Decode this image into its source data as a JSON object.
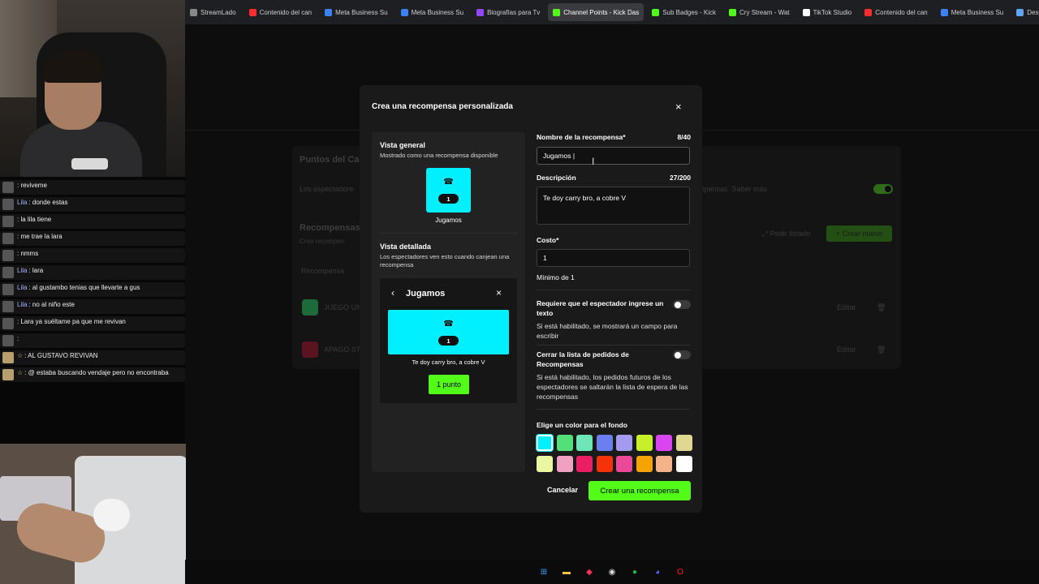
{
  "browser": {
    "tabs": [
      {
        "label": "StreamLado",
        "color": "#888888"
      },
      {
        "label": "Contenido del can",
        "color": "#ff2d2d"
      },
      {
        "label": "Meta Business Su",
        "color": "#3b82f6"
      },
      {
        "label": "Meta Business Su",
        "color": "#3b82f6"
      },
      {
        "label": "Biografías para Tv",
        "color": "#9146ff"
      },
      {
        "label": "Channel Points - Kick Das",
        "color": "#53fc18",
        "active": true
      },
      {
        "label": "Sub Badges - Kick",
        "color": "#53fc18"
      },
      {
        "label": "Cry Stream - Wat",
        "color": "#53fc18"
      },
      {
        "label": "TikTok Studio",
        "color": "#ffffff"
      },
      {
        "label": "Contenido del can",
        "color": "#ff2d2d"
      },
      {
        "label": "Meta Business Su",
        "color": "#3b82f6"
      },
      {
        "label": "Descargar arch",
        "color": "#60a5fa"
      }
    ]
  },
  "background": {
    "section_title": "Puntos del Ca",
    "info_text": "Los espectadore",
    "info_tail": "mpensas. Saber más",
    "rewards_title": "Recompensas",
    "rewards_sub": "Crea recompen",
    "request_label": "Pedir listado",
    "create_new_label": "Crear nuevo",
    "col_header": "Recompensa",
    "rows": [
      {
        "name": "JUEGO UN",
        "edit": "Editar",
        "icon_color": "#1d6b3a"
      },
      {
        "name": "APAGO ST",
        "edit": "Editar",
        "icon_color": "#5a1420"
      }
    ]
  },
  "chat": [
    {
      "name": "",
      "text": ": reviveme",
      "gold": false
    },
    {
      "name": "Lila",
      "text": ": donde estas",
      "gold": false
    },
    {
      "name": "",
      "text": ": la lila tiene",
      "gold": false
    },
    {
      "name": "",
      "text": ": me trae la lara",
      "gold": false
    },
    {
      "name": "",
      "text": ": nmms",
      "gold": false
    },
    {
      "name": "Lila",
      "text": ": lara",
      "gold": false
    },
    {
      "name": "Lila",
      "text": ": al gustambo tenias que llevarte a gus",
      "gold": false
    },
    {
      "name": "Lila",
      "text": ": no al niño este",
      "gold": false
    },
    {
      "name": "",
      "text": ": Lara ya suéltame pa que me revivan",
      "gold": false
    },
    {
      "name": "",
      "text": ":",
      "gold": false
    },
    {
      "name": "☆",
      "text": ": AL GUSTAVO REVIVAN",
      "gold": true
    },
    {
      "name": "☆",
      "text": ": @ estaba buscando vendaje pero no encontraba",
      "gold": true
    }
  ],
  "modal": {
    "title": "Crea una recompensa personalizada",
    "close_icon": "×",
    "preview": {
      "overview_title": "Vista general",
      "overview_sub": "Mostrado como una recompensa disponible",
      "tile_count": "1",
      "tile_name": "Jugamos",
      "detail_title": "Vista detallada",
      "detail_sub": "Los espectadores ven esto cuando canjean una recompensa",
      "card_title": "Jugamos",
      "card_count": "1",
      "card_desc": "Te doy carry bro, a cobre V",
      "card_cost": "1 punto"
    },
    "form": {
      "name_label": "Nombre de la recompensa*",
      "name_count": "8/40",
      "name_value": "Jugamos |",
      "desc_label": "Descripción",
      "desc_count": "27/200",
      "desc_value": "Te doy carry bro, a cobre V",
      "cost_label": "Costo*",
      "cost_value": "1",
      "cost_hint": "Mínimo de 1",
      "toggle1_label": "Requiere que el espectador ingrese un texto",
      "toggle1_desc": "Si está habilitado, se mostrará un campo para escribir",
      "toggle2_label": "Cerrar la lista de pedidos de Recompensas",
      "toggle2_desc": "Si está habilitado, los pedidos futuros de los espectadores se saltarán la lista de espera de las recompensas",
      "color_label": "Elige un color para el fondo",
      "colors": [
        "#00f0ff",
        "#53e07a",
        "#6ee6b8",
        "#6b7ff0",
        "#a39bf0",
        "#c8f02a",
        "#d946ef",
        "#e0d890",
        "#eaf6a0",
        "#f0a0c0",
        "#e91e63",
        "#f4330b",
        "#ec4899",
        "#f5a300",
        "#f6b38a",
        "#ffffff"
      ],
      "selected_color": "#00f0ff",
      "cancel_label": "Cancelar",
      "submit_label": "Crear una recompensa"
    }
  },
  "taskbar": [
    {
      "name": "windows-start-icon",
      "glyph": "⊞",
      "color": "#3aa0ff"
    },
    {
      "name": "file-explorer-icon",
      "glyph": "▬",
      "color": "#f5c542"
    },
    {
      "name": "app-red-icon",
      "glyph": "◆",
      "color": "#ff3355"
    },
    {
      "name": "obs-icon",
      "glyph": "◉",
      "color": "#dddddd"
    },
    {
      "name": "spotify-icon",
      "glyph": "●",
      "color": "#1db954"
    },
    {
      "name": "discord-icon",
      "glyph": "◕",
      "color": "#5865f2"
    },
    {
      "name": "opera-icon",
      "glyph": "O",
      "color": "#ff1b2d"
    }
  ]
}
